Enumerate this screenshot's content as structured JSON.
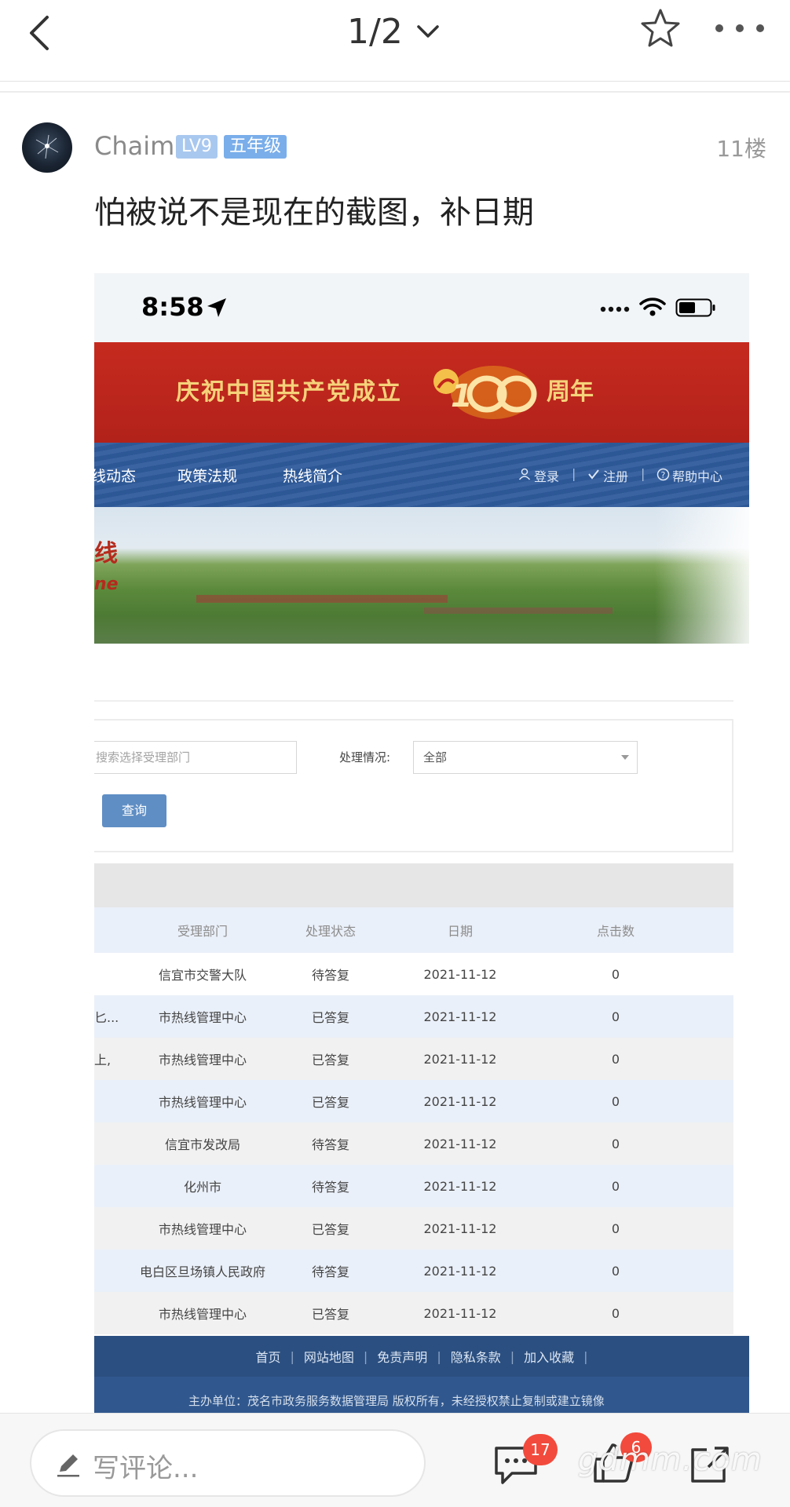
{
  "topbar": {
    "page_indicator": "1/2"
  },
  "post": {
    "username": "Chaim",
    "level_badge": "LV9",
    "grade_badge": "五年级",
    "floor": "11楼",
    "text": "怕被说不是现在的截图，补日期"
  },
  "screenshot": {
    "status_time": "8:58",
    "banner_left": "庆祝中国共产党成立",
    "banner_right": "周年",
    "nav": {
      "items": [
        "线动态",
        "政策法规",
        "热线简介"
      ],
      "login": "登录",
      "register": "注册",
      "help": "帮助中心"
    },
    "hero_title_fragment": "线",
    "hero_subtitle_fragment": "ne",
    "search": {
      "dept_placeholder": "搜索选择受理部门",
      "status_label": "处理情况:",
      "status_value": "全部",
      "query_label": "查询"
    },
    "table": {
      "headers": [
        "受理部门",
        "处理状态",
        "日期",
        "点击数"
      ],
      "rows": [
        {
          "prefix": "",
          "dept": "信宜市交警大队",
          "status": "待答复",
          "date": "2021-11-12",
          "clicks": "0"
        },
        {
          "prefix": "匕...",
          "dept": "市热线管理中心",
          "status": "已答复",
          "date": "2021-11-12",
          "clicks": "0"
        },
        {
          "prefix": "上,",
          "dept": "市热线管理中心",
          "status": "已答复",
          "date": "2021-11-12",
          "clicks": "0"
        },
        {
          "prefix": "",
          "dept": "市热线管理中心",
          "status": "已答复",
          "date": "2021-11-12",
          "clicks": "0"
        },
        {
          "prefix": "",
          "dept": "信宜市发改局",
          "status": "待答复",
          "date": "2021-11-12",
          "clicks": "0"
        },
        {
          "prefix": "",
          "dept": "化州市",
          "status": "待答复",
          "date": "2021-11-12",
          "clicks": "0"
        },
        {
          "prefix": "",
          "dept": "市热线管理中心",
          "status": "已答复",
          "date": "2021-11-12",
          "clicks": "0"
        },
        {
          "prefix": "",
          "dept": "电白区旦场镇人民政府",
          "status": "待答复",
          "date": "2021-11-12",
          "clicks": "0"
        },
        {
          "prefix": "",
          "dept": "市热线管理中心",
          "status": "已答复",
          "date": "2021-11-12",
          "clicks": "0"
        }
      ]
    },
    "footer": {
      "links": [
        "首页",
        "网站地图",
        "免责声明",
        "隐私条款",
        "加入收藏"
      ],
      "text": "主办单位：茂名市政务服务数据管理局 版权所有，未经授权禁止复制或建立镜像"
    }
  },
  "bottombar": {
    "comment_placeholder": "写评论...",
    "comment_count": "17",
    "like_count": "6",
    "watermark": "gdmm.com"
  }
}
